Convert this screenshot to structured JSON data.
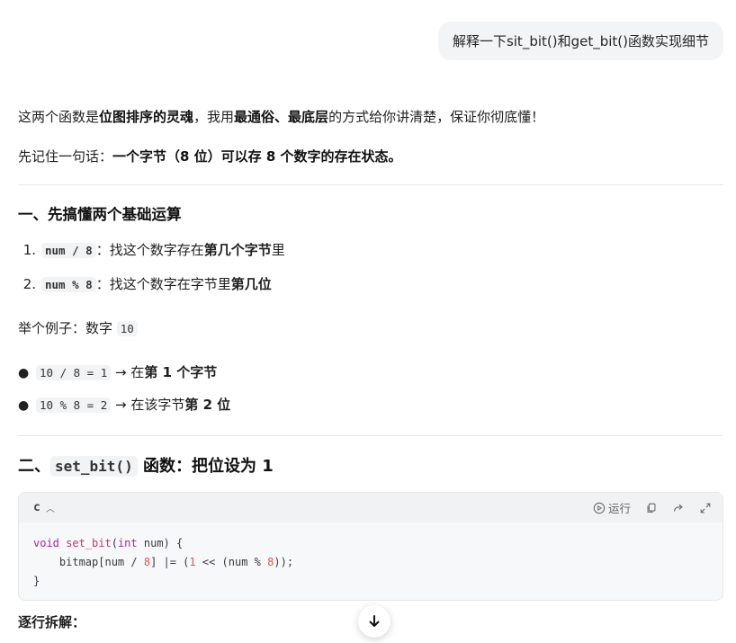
{
  "user_message": "解释一下sit_bit()和get_bit()函数实现细节",
  "intro": {
    "text1": "这两个函数是",
    "bold1": "位图排序的灵魂",
    "text2": "，我用",
    "bold2": "最通俗、最底层",
    "text3": "的方式给你讲清楚，保证你彻底懂！"
  },
  "remember": {
    "text1": "先记住一句话：",
    "bold1": "一个字节（8 位）可以存 8 个数字的存在状态。"
  },
  "section1": {
    "title": "一、先搞懂两个基础运算",
    "items": [
      {
        "num": "1.",
        "code": "num / 8",
        "text": "：找这个数字存在",
        "bold": "第几个字节",
        "tail": "里"
      },
      {
        "num": "2.",
        "code": "num % 8",
        "text": "：找这个数字在字节里",
        "bold": "第几位",
        "tail": ""
      }
    ],
    "example_text": "举个例子：数字 ",
    "example_code": "10",
    "bullets": [
      {
        "code": "10 / 8 = 1",
        "text": " → 在",
        "bold": "第 1 个字节"
      },
      {
        "code": "10 % 8 = 2",
        "text": " → 在该字节",
        "bold": "第 2 位"
      }
    ]
  },
  "section2": {
    "prefix": "二、",
    "code": "set_bit()",
    "suffix": " 函数：把位设为 1"
  },
  "code_block": {
    "language": "c",
    "run_label": "运行",
    "line1_kw": "void",
    "line1_fn": "set_bit",
    "line1_kw2": "int",
    "line1_rest": " num) {",
    "line2_a": "    bitmap[num / ",
    "line2_n1": "8",
    "line2_b": "] |= (",
    "line2_n2": "1",
    "line2_c": " << (num % ",
    "line2_n3": "8",
    "line2_d": "));",
    "line3": "}"
  },
  "breakdown_title": "逐行拆解："
}
